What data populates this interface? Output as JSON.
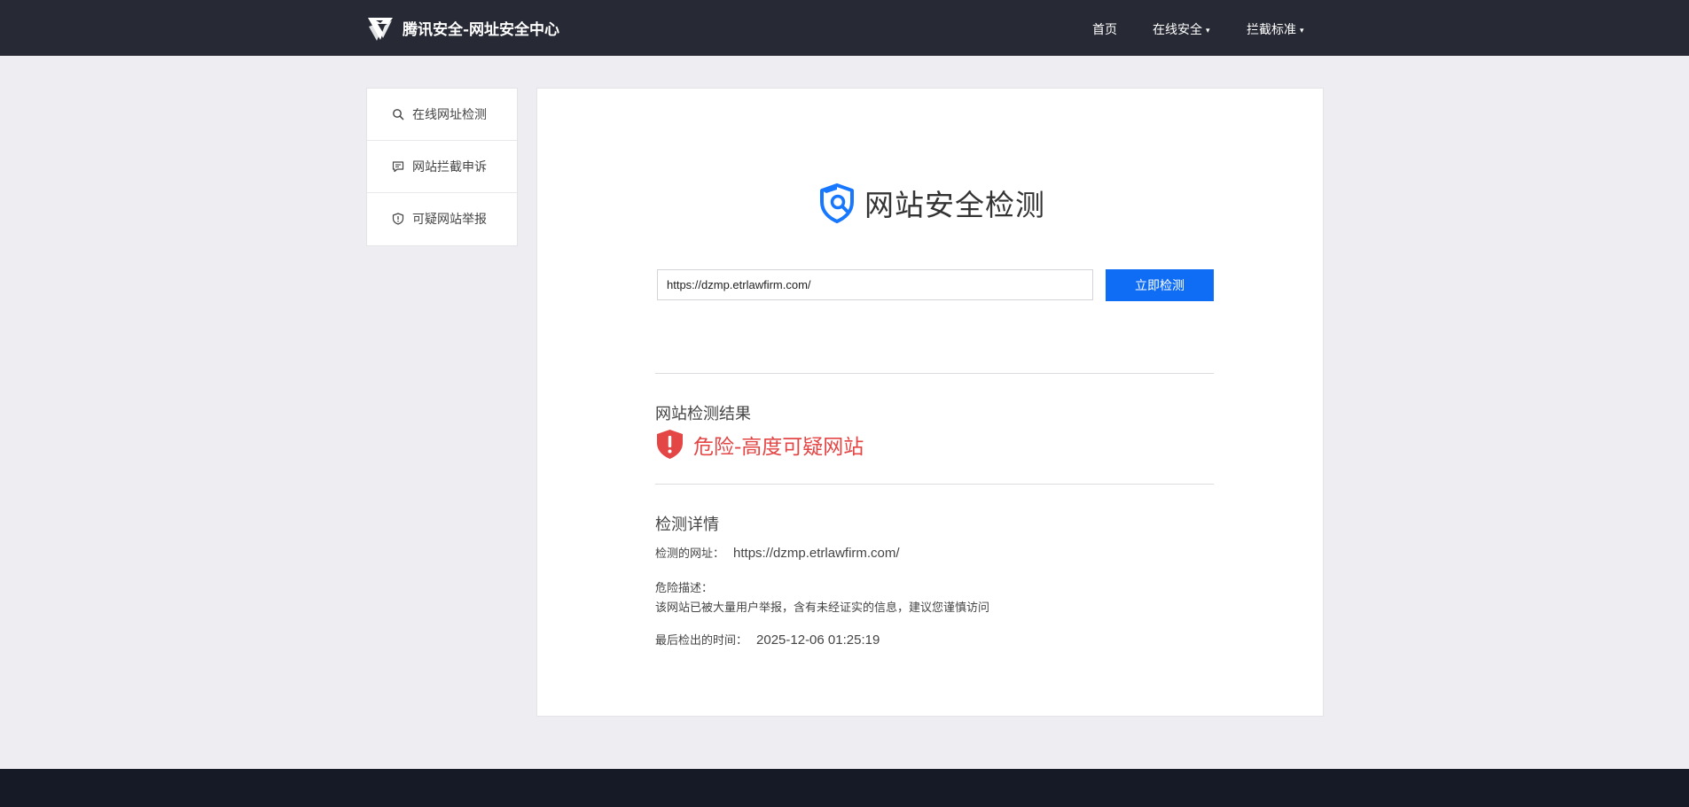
{
  "header": {
    "brand_title": "腾讯安全-网址安全中心",
    "nav": [
      {
        "label": "首页",
        "has_caret": false
      },
      {
        "label": "在线安全",
        "has_caret": true
      },
      {
        "label": "拦截标准",
        "has_caret": true
      }
    ],
    "caret": "▾"
  },
  "sidebar": {
    "items": [
      {
        "label": "在线网址检测",
        "icon": "search-icon"
      },
      {
        "label": "网站拦截申诉",
        "icon": "message-icon"
      },
      {
        "label": "可疑网站举报",
        "icon": "shield-alert-icon"
      }
    ]
  },
  "main": {
    "hero_title": "网站安全检测",
    "url_input_value": "https://dzmp.etrlawfirm.com/",
    "check_button_label": "立即检测",
    "result_heading": "网站检测结果",
    "result_status": "危险-高度可疑网站",
    "detail_heading": "检测详情",
    "details": {
      "url_label": "检测的网址：",
      "url_value": "https://dzmp.etrlawfirm.com/",
      "risk_label": "危险描述：",
      "risk_text": "该网站已被大量用户举报，含有未经证实的信息，建议您谨慎访问",
      "time_label": "最后检出的时间：",
      "time_value": "2025-12-06 01:25:19"
    }
  },
  "colors": {
    "header_bg": "#272a35",
    "accent_blue": "#0f6cf5",
    "danger_red": "#e44545",
    "footer_bg": "#161a27"
  }
}
